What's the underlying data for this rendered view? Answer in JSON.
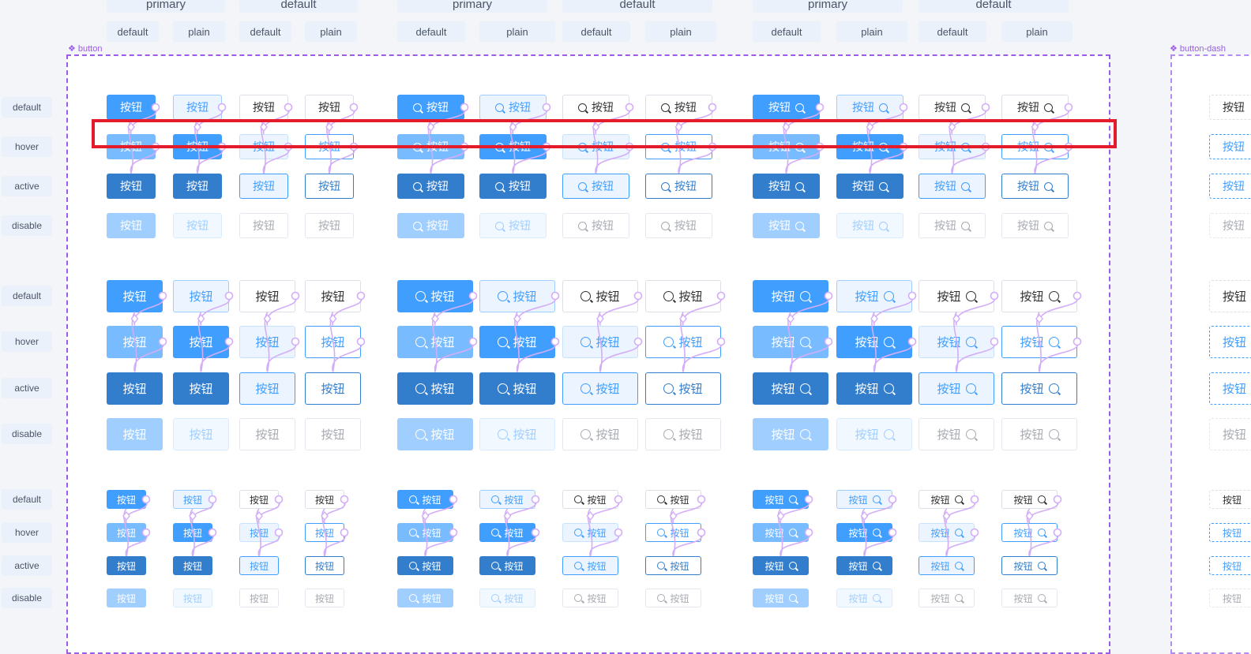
{
  "top_headers": [
    "primary",
    "default",
    "primary",
    "default",
    "primary",
    "default"
  ],
  "sub_headers": [
    "default",
    "plain",
    "default",
    "plain",
    "default",
    "plain",
    "default",
    "plain",
    "default",
    "plain",
    "default",
    "plain"
  ],
  "frame_labels": {
    "main": "button",
    "secondary": "button-dash"
  },
  "state_labels": [
    "default",
    "hover",
    "active",
    "disable"
  ],
  "button_text": "按钮",
  "colors": {
    "primary": "#409eff",
    "primary_hover": "#79bbff",
    "primary_active": "#337ecc",
    "primary_disabled": "#a0cfff",
    "plain_bg": "#ecf5ff",
    "plain_border": "#a0cfff",
    "text": "#303133",
    "muted": "#a8abb2",
    "frame": "#9b5de5",
    "highlight": "#e31b2b",
    "connector": "#d3adf7"
  },
  "icons": {
    "search": "search-icon",
    "component": "component-icon"
  }
}
